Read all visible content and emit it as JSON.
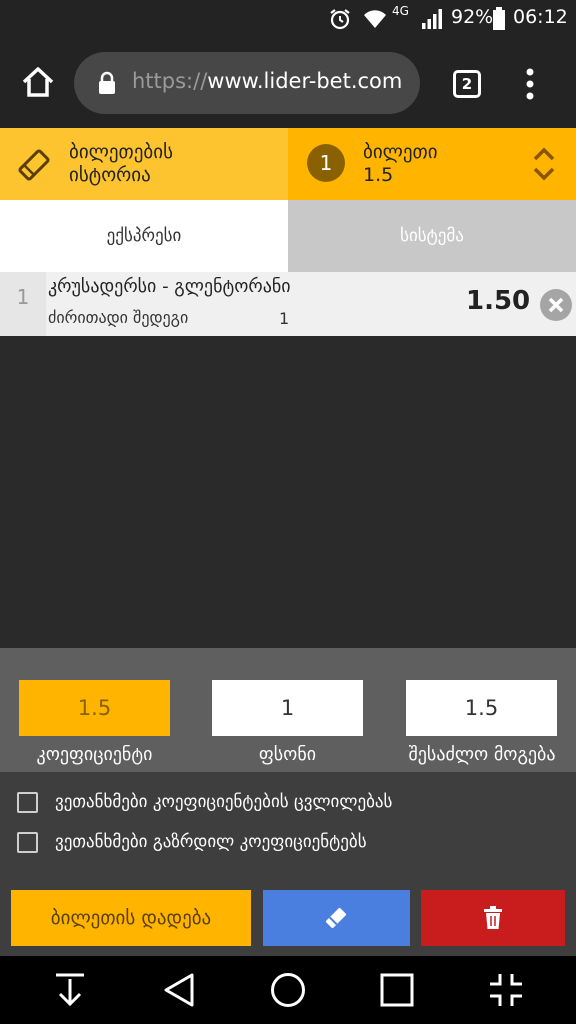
{
  "status": {
    "battery_percent": "92%",
    "time": "06:12",
    "network": "4G"
  },
  "browser": {
    "url_prefix": "https://",
    "url_domain": "www.lider-bet.com",
    "tab_count": "2"
  },
  "ticket_header": {
    "history_line1": "ბილეთების",
    "history_line2": "ისტორია",
    "badge": "1",
    "ticket_title": "ბილეთი",
    "ticket_value": "1.5"
  },
  "tabs": {
    "express": "ექსპრესი",
    "system": "სისტემა"
  },
  "bet": {
    "index": "1",
    "match": "კრუსადერსი - გლენტორანი",
    "market": "ძირითადი შედეგი",
    "selection": "1",
    "odds": "1.50"
  },
  "summary": {
    "coef_value": "1.5",
    "coef_label": "კოეფიციენტი",
    "stake_value": "1",
    "stake_label": "ფსონი",
    "win_value": "1.5",
    "win_label": "შესაძლო მოგება"
  },
  "agreements": {
    "accept_changes": "ვეთანხმები კოეფიციენტების ცვლილებას",
    "accept_increase": "ვეთანხმები გაზრდილ კოეფიციენტებს"
  },
  "actions": {
    "place_bet": "ბილეთის დადება"
  },
  "colors": {
    "accent_yellow": "#ffb400",
    "blue_button": "#4a7fe0",
    "red_button": "#c91c1c"
  }
}
